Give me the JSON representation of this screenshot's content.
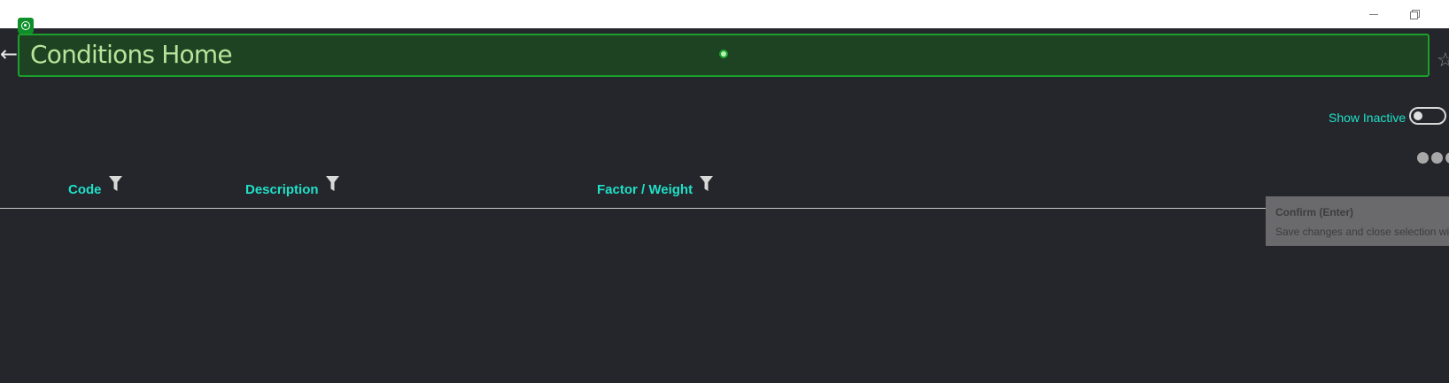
{
  "window": {
    "minimize_glyph": "minimize-icon",
    "restore_glyph": "restore-icon"
  },
  "header": {
    "title": "Conditions Home",
    "back_icon": "arrow-left-icon",
    "favorite_icon": "star-outline-icon",
    "accent_color": "#1ba02c",
    "background_color": "#1d4322"
  },
  "filters": {
    "show_inactive_label": "Show Inactive",
    "show_inactive_on": false
  },
  "table": {
    "columns": [
      {
        "label": "Code",
        "icon": "filter-icon"
      },
      {
        "label": "Description",
        "icon": "filter-icon"
      },
      {
        "label": "Factor / Weight",
        "icon": "filter-icon"
      }
    ],
    "rows": []
  },
  "tooltip": {
    "title": "Confirm (Enter)",
    "text": "Save changes and close selection wizard"
  },
  "colors": {
    "page_background": "#25262b",
    "column_header_text": "#1fe0c8"
  }
}
